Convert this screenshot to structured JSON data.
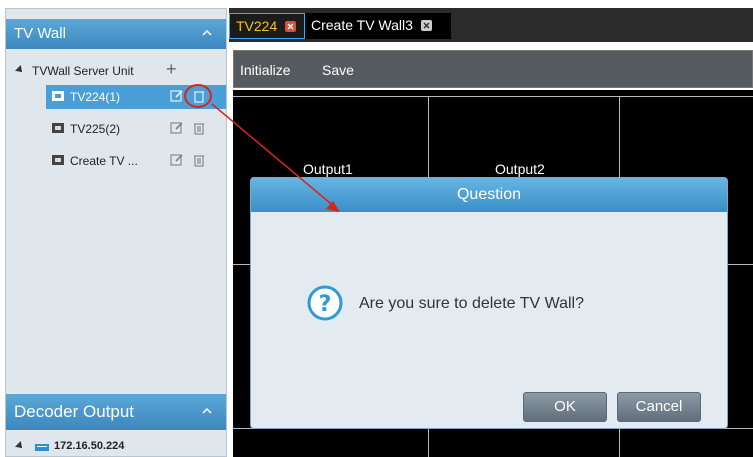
{
  "left_panel": {
    "tvwall_header": "TV Wall",
    "server_unit": "TVWall Server Unit",
    "items": [
      {
        "label": "TV224(1)"
      },
      {
        "label": "TV225(2)"
      },
      {
        "label": "Create TV ..."
      }
    ],
    "decoder_header": "Decoder Output",
    "decoder_item": "172.16.50.224"
  },
  "tabs": [
    {
      "label": "TV224"
    },
    {
      "label": "Create TV Wall3"
    }
  ],
  "toolbar": {
    "initialize_label": "Initialize",
    "save_label": "Save"
  },
  "wall": {
    "outputs": [
      "Output1",
      "Output2"
    ]
  },
  "dialog": {
    "title": "Question",
    "message": "Are you sure to delete TV Wall?",
    "ok_label": "OK",
    "cancel_label": "Cancel"
  },
  "colors": {
    "accent_blue": "#3d87be",
    "tab_active_text": "#f5c518",
    "annotation_red": "#d9241c"
  }
}
